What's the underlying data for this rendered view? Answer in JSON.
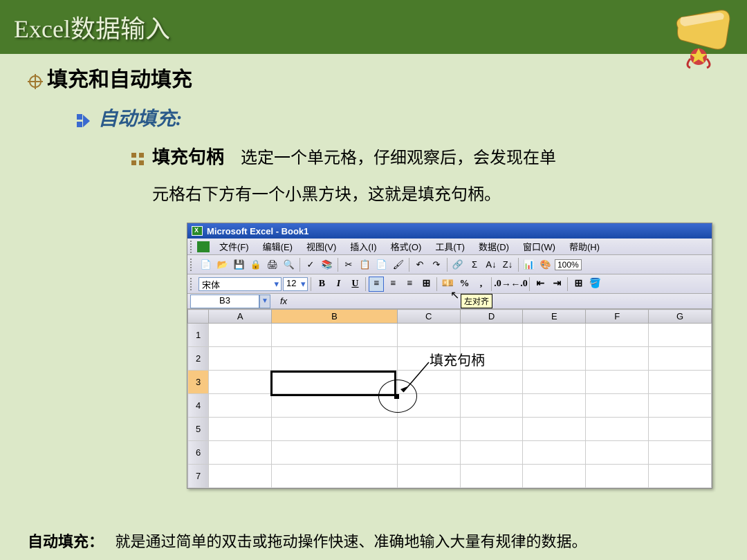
{
  "title": "Excel数据输入",
  "h1": "填充和自动填充",
  "h2": "自动填充:",
  "h3_label": "填充句柄",
  "h3_desc": "选定一个单元格，仔细观察后，会发现在单",
  "h3_cont": "元格右下方有一个小黑方块，这就是填充句柄。",
  "excel": {
    "window_title": "Microsoft Excel - Book1",
    "menus": [
      "文件(F)",
      "编辑(E)",
      "视图(V)",
      "插入(I)",
      "格式(O)",
      "工具(T)",
      "数据(D)",
      "窗口(W)",
      "帮助(H)"
    ],
    "font_name": "宋体",
    "font_size": "12",
    "zoom": "100%",
    "name_box": "B3",
    "fx": "fx",
    "tooltip": "左对齐",
    "columns": [
      "A",
      "B",
      "C",
      "D",
      "E",
      "F",
      "G"
    ],
    "rows": [
      "1",
      "2",
      "3",
      "4",
      "5",
      "6",
      "7"
    ]
  },
  "annotation": "填充句柄",
  "footer_label": "自动填充：",
  "footer_text": "就是通过简单的双击或拖动操作快速、准确地输入大量有规律的数据。"
}
